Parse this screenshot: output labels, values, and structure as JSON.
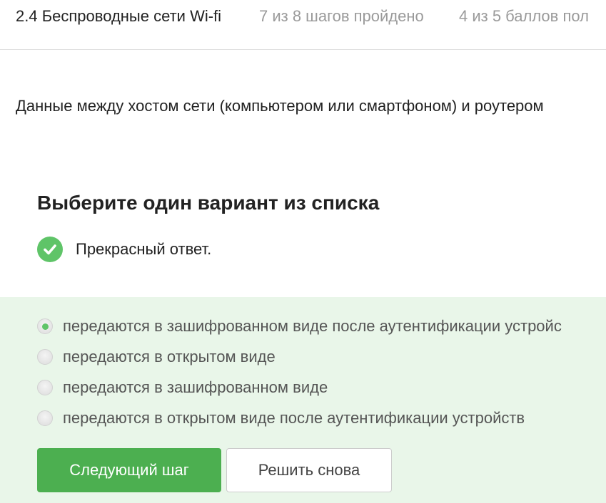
{
  "header": {
    "lesson_title": "2.4 Беспроводные сети Wi-fi",
    "steps_progress": "7 из 8 шагов пройдено",
    "score_progress": "4 из 5 баллов  пол"
  },
  "question": {
    "text": "Данные между хостом сети (компьютером или смартфоном) и роутером"
  },
  "quiz": {
    "heading": "Выберите один вариант из списка",
    "feedback_icon": "check-circle-icon",
    "feedback_text": "Прекрасный ответ.",
    "options": [
      {
        "label": "передаются в зашифрованном виде после аутентификации устройс",
        "selected": true
      },
      {
        "label": "передаются в открытом виде",
        "selected": false
      },
      {
        "label": "передаются в зашифрованном виде",
        "selected": false
      },
      {
        "label": "передаются в открытом виде после аутентификации устройств",
        "selected": false
      }
    ],
    "next_button": "Следующий шаг",
    "retry_button": "Решить снова"
  },
  "colors": {
    "accent_green": "#4caf50",
    "success_green": "#5fc468",
    "answers_background": "#e9f6e9"
  }
}
